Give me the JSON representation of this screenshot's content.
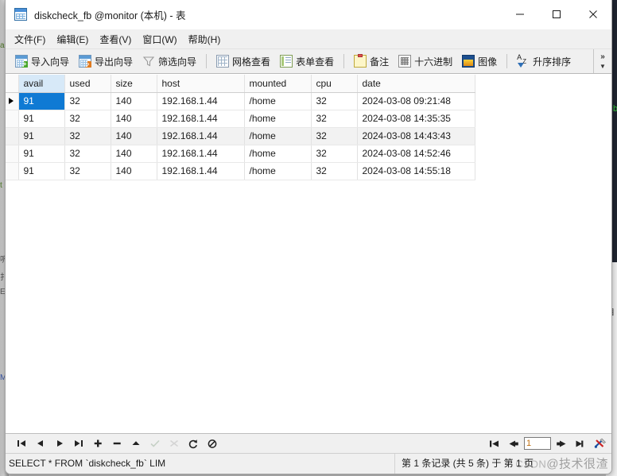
{
  "window": {
    "title": "diskcheck_fb @monitor (本机) - 表",
    "icon": "table-icon",
    "controls": {
      "minimize": "minimize-icon",
      "maximize": "maximize-icon",
      "close": "close-icon"
    }
  },
  "menubar": {
    "items": [
      {
        "label": "文件(F)",
        "name": "menu-file"
      },
      {
        "label": "编辑(E)",
        "name": "menu-edit"
      },
      {
        "label": "查看(V)",
        "name": "menu-view"
      },
      {
        "label": "窗口(W)",
        "name": "menu-window"
      },
      {
        "label": "帮助(H)",
        "name": "menu-help"
      }
    ]
  },
  "toolbar": {
    "items": [
      {
        "label": "导入向导",
        "icon": "import-wizard-icon"
      },
      {
        "label": "导出向导",
        "icon": "export-wizard-icon"
      },
      {
        "label": "筛选向导",
        "icon": "filter-wizard-icon"
      },
      {
        "label": "网格查看",
        "icon": "grid-view-icon"
      },
      {
        "label": "表单查看",
        "icon": "form-view-icon"
      },
      {
        "label": "备注",
        "icon": "memo-icon"
      },
      {
        "label": "十六进制",
        "icon": "hex-icon"
      },
      {
        "label": "图像",
        "icon": "image-icon"
      },
      {
        "label": "升序排序",
        "icon": "sort-ascending-icon"
      }
    ],
    "overflow": "»"
  },
  "grid": {
    "columns": [
      {
        "key": "avail",
        "label": "avail",
        "active": true
      },
      {
        "key": "used",
        "label": "used",
        "active": false
      },
      {
        "key": "size",
        "label": "size",
        "active": false
      },
      {
        "key": "host",
        "label": "host",
        "active": false
      },
      {
        "key": "mounted",
        "label": "mounted",
        "active": false
      },
      {
        "key": "cpu",
        "label": "cpu",
        "active": false
      },
      {
        "key": "date",
        "label": "date",
        "active": false
      }
    ],
    "rows": [
      {
        "avail": "91",
        "used": "32",
        "size": "140",
        "host": "192.168.1.44",
        "mounted": "/home",
        "cpu": "32",
        "date": "2024-03-08 09:21:48",
        "current": true
      },
      {
        "avail": "91",
        "used": "32",
        "size": "140",
        "host": "192.168.1.44",
        "mounted": "/home",
        "cpu": "32",
        "date": "2024-03-08 14:35:35",
        "current": false
      },
      {
        "avail": "91",
        "used": "32",
        "size": "140",
        "host": "192.168.1.44",
        "mounted": "/home",
        "cpu": "32",
        "date": "2024-03-08 14:43:43",
        "current": false
      },
      {
        "avail": "91",
        "used": "32",
        "size": "140",
        "host": "192.168.1.44",
        "mounted": "/home",
        "cpu": "32",
        "date": "2024-03-08 14:52:46",
        "current": false
      },
      {
        "avail": "91",
        "used": "32",
        "size": "140",
        "host": "192.168.1.44",
        "mounted": "/home",
        "cpu": "32",
        "date": "2024-03-08 14:55:18",
        "current": false
      }
    ],
    "selected_cell": {
      "row": 0,
      "column": "avail",
      "value": "91"
    }
  },
  "navbar": {
    "buttons": [
      {
        "name": "first-record-button",
        "icon": "first-icon",
        "disabled": false
      },
      {
        "name": "previous-record-button",
        "icon": "previous-icon",
        "disabled": false
      },
      {
        "name": "next-record-button",
        "icon": "next-icon",
        "disabled": false
      },
      {
        "name": "last-record-button",
        "icon": "last-icon",
        "disabled": false
      },
      {
        "name": "add-record-button",
        "icon": "plus-icon",
        "disabled": false
      },
      {
        "name": "delete-record-button",
        "icon": "minus-icon",
        "disabled": false
      },
      {
        "name": "edit-record-button",
        "icon": "caret-up-icon",
        "disabled": false
      },
      {
        "name": "confirm-button",
        "icon": "check-icon",
        "disabled": true
      },
      {
        "name": "cancel-edit-button",
        "icon": "cross-icon",
        "disabled": true
      },
      {
        "name": "refresh-button",
        "icon": "refresh-icon",
        "disabled": false
      },
      {
        "name": "stop-button",
        "icon": "stop-icon",
        "disabled": false
      }
    ]
  },
  "pager": {
    "first_page": "first-page-icon",
    "previous_page": "previous-page-icon",
    "page_value": "1",
    "next_page": "next-page-icon",
    "last_page": "last-page-icon",
    "tools": "tools-icon"
  },
  "statusbar": {
    "sql": "SELECT * FROM `diskcheck_fb` LIM",
    "record_info": "第 1 条记录 (共 5 条) 于 第 1 页",
    "watermark": "@技术很渣",
    "watermark_small": "CSDN"
  },
  "background": {
    "terminal_lines": [
      "fb",
      "s"
    ],
    "left_fragments": [
      "a",
      "t",
      "呎",
      "扌",
      "E",
      "M"
    ]
  },
  "colors": {
    "accent": "#0f7ad4",
    "column_active": "#d7e9f8",
    "titlebar": "#ffffff",
    "chrome": "#f0f0f0"
  }
}
